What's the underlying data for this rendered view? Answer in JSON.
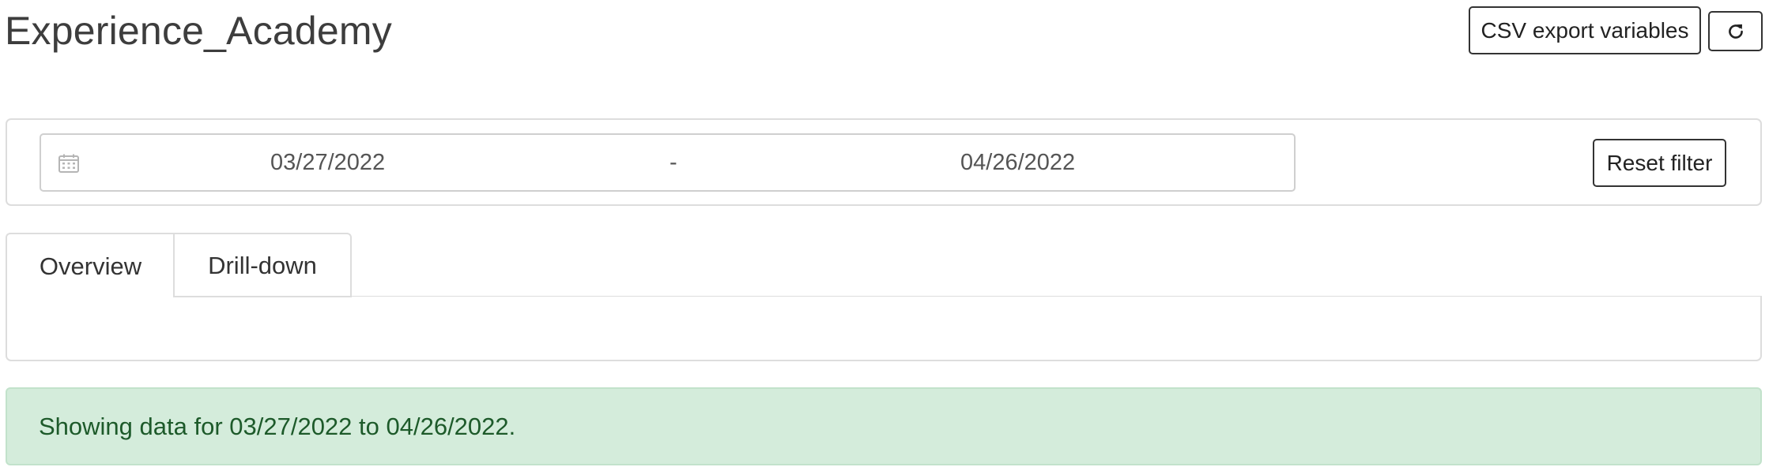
{
  "header": {
    "title": "Experience_Academy",
    "csv_export_label": "CSV export variables",
    "refresh_icon": "refresh-icon"
  },
  "filter": {
    "calendar_icon": "calendar-icon",
    "start_date": "03/27/2022",
    "separator": "-",
    "end_date": "04/26/2022",
    "reset_label": "Reset filter"
  },
  "tabs": [
    {
      "label": "Overview",
      "active": true
    },
    {
      "label": "Drill-down",
      "active": false
    }
  ],
  "alert": {
    "message": "Showing data for 03/27/2022 to 04/26/2022.",
    "background": "#d4ecdb",
    "text_color": "#1d5a2a"
  }
}
